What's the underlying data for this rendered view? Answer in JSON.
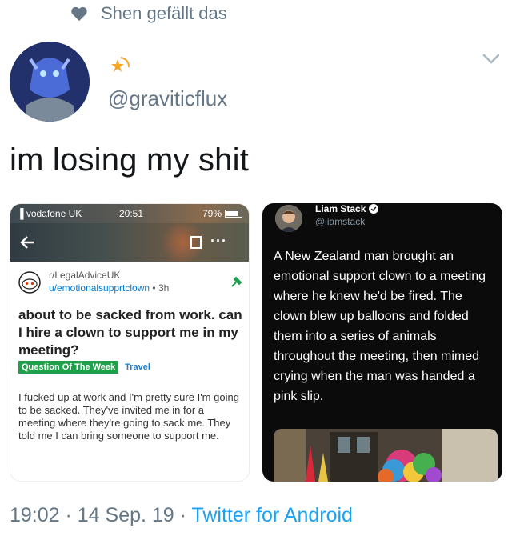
{
  "social_context": {
    "text": "Shen gefällt das",
    "icon": "heart-icon"
  },
  "author": {
    "handle": "@graviticflux",
    "display_name_icon": "star-emoji-icon"
  },
  "tweet": {
    "text": "im losing my shit"
  },
  "reddit_screenshot": {
    "status_bar": {
      "carrier": "vodafone UK",
      "time": "20:51",
      "battery": "79%"
    },
    "subreddit": "r/LegalAdviceUK",
    "username": "u/emotionalsupprtclown",
    "age": "3h",
    "title": "about to be sacked from work. can I hire a clown to support me in my meeting?",
    "flair_primary": "Question Of The Week",
    "flair_secondary": "Travel",
    "body": "I fucked up at work and I'm pretty sure I'm going to be sacked. They've invited me in for a meeting where they're going to sack me. They told me I can bring someone to support me."
  },
  "twitter_screenshot": {
    "name": "Liam Stack",
    "handle": "@liamstack",
    "text": "A New Zealand man brought an emotional support clown to a meeting where he knew he'd be fired. The clown blew up balloons and folded them into a series of animals throughout the meeting, then mimed crying when the man was handed a pink slip."
  },
  "meta": {
    "timestamp": "19:02 · 14 Sep. 19 · ",
    "source": "Twitter for Android"
  },
  "colors": {
    "secondary_text": "#657786",
    "link": "#1da1f2",
    "flair_green": "#1fa04a",
    "reddit_blue": "#0079d3"
  }
}
